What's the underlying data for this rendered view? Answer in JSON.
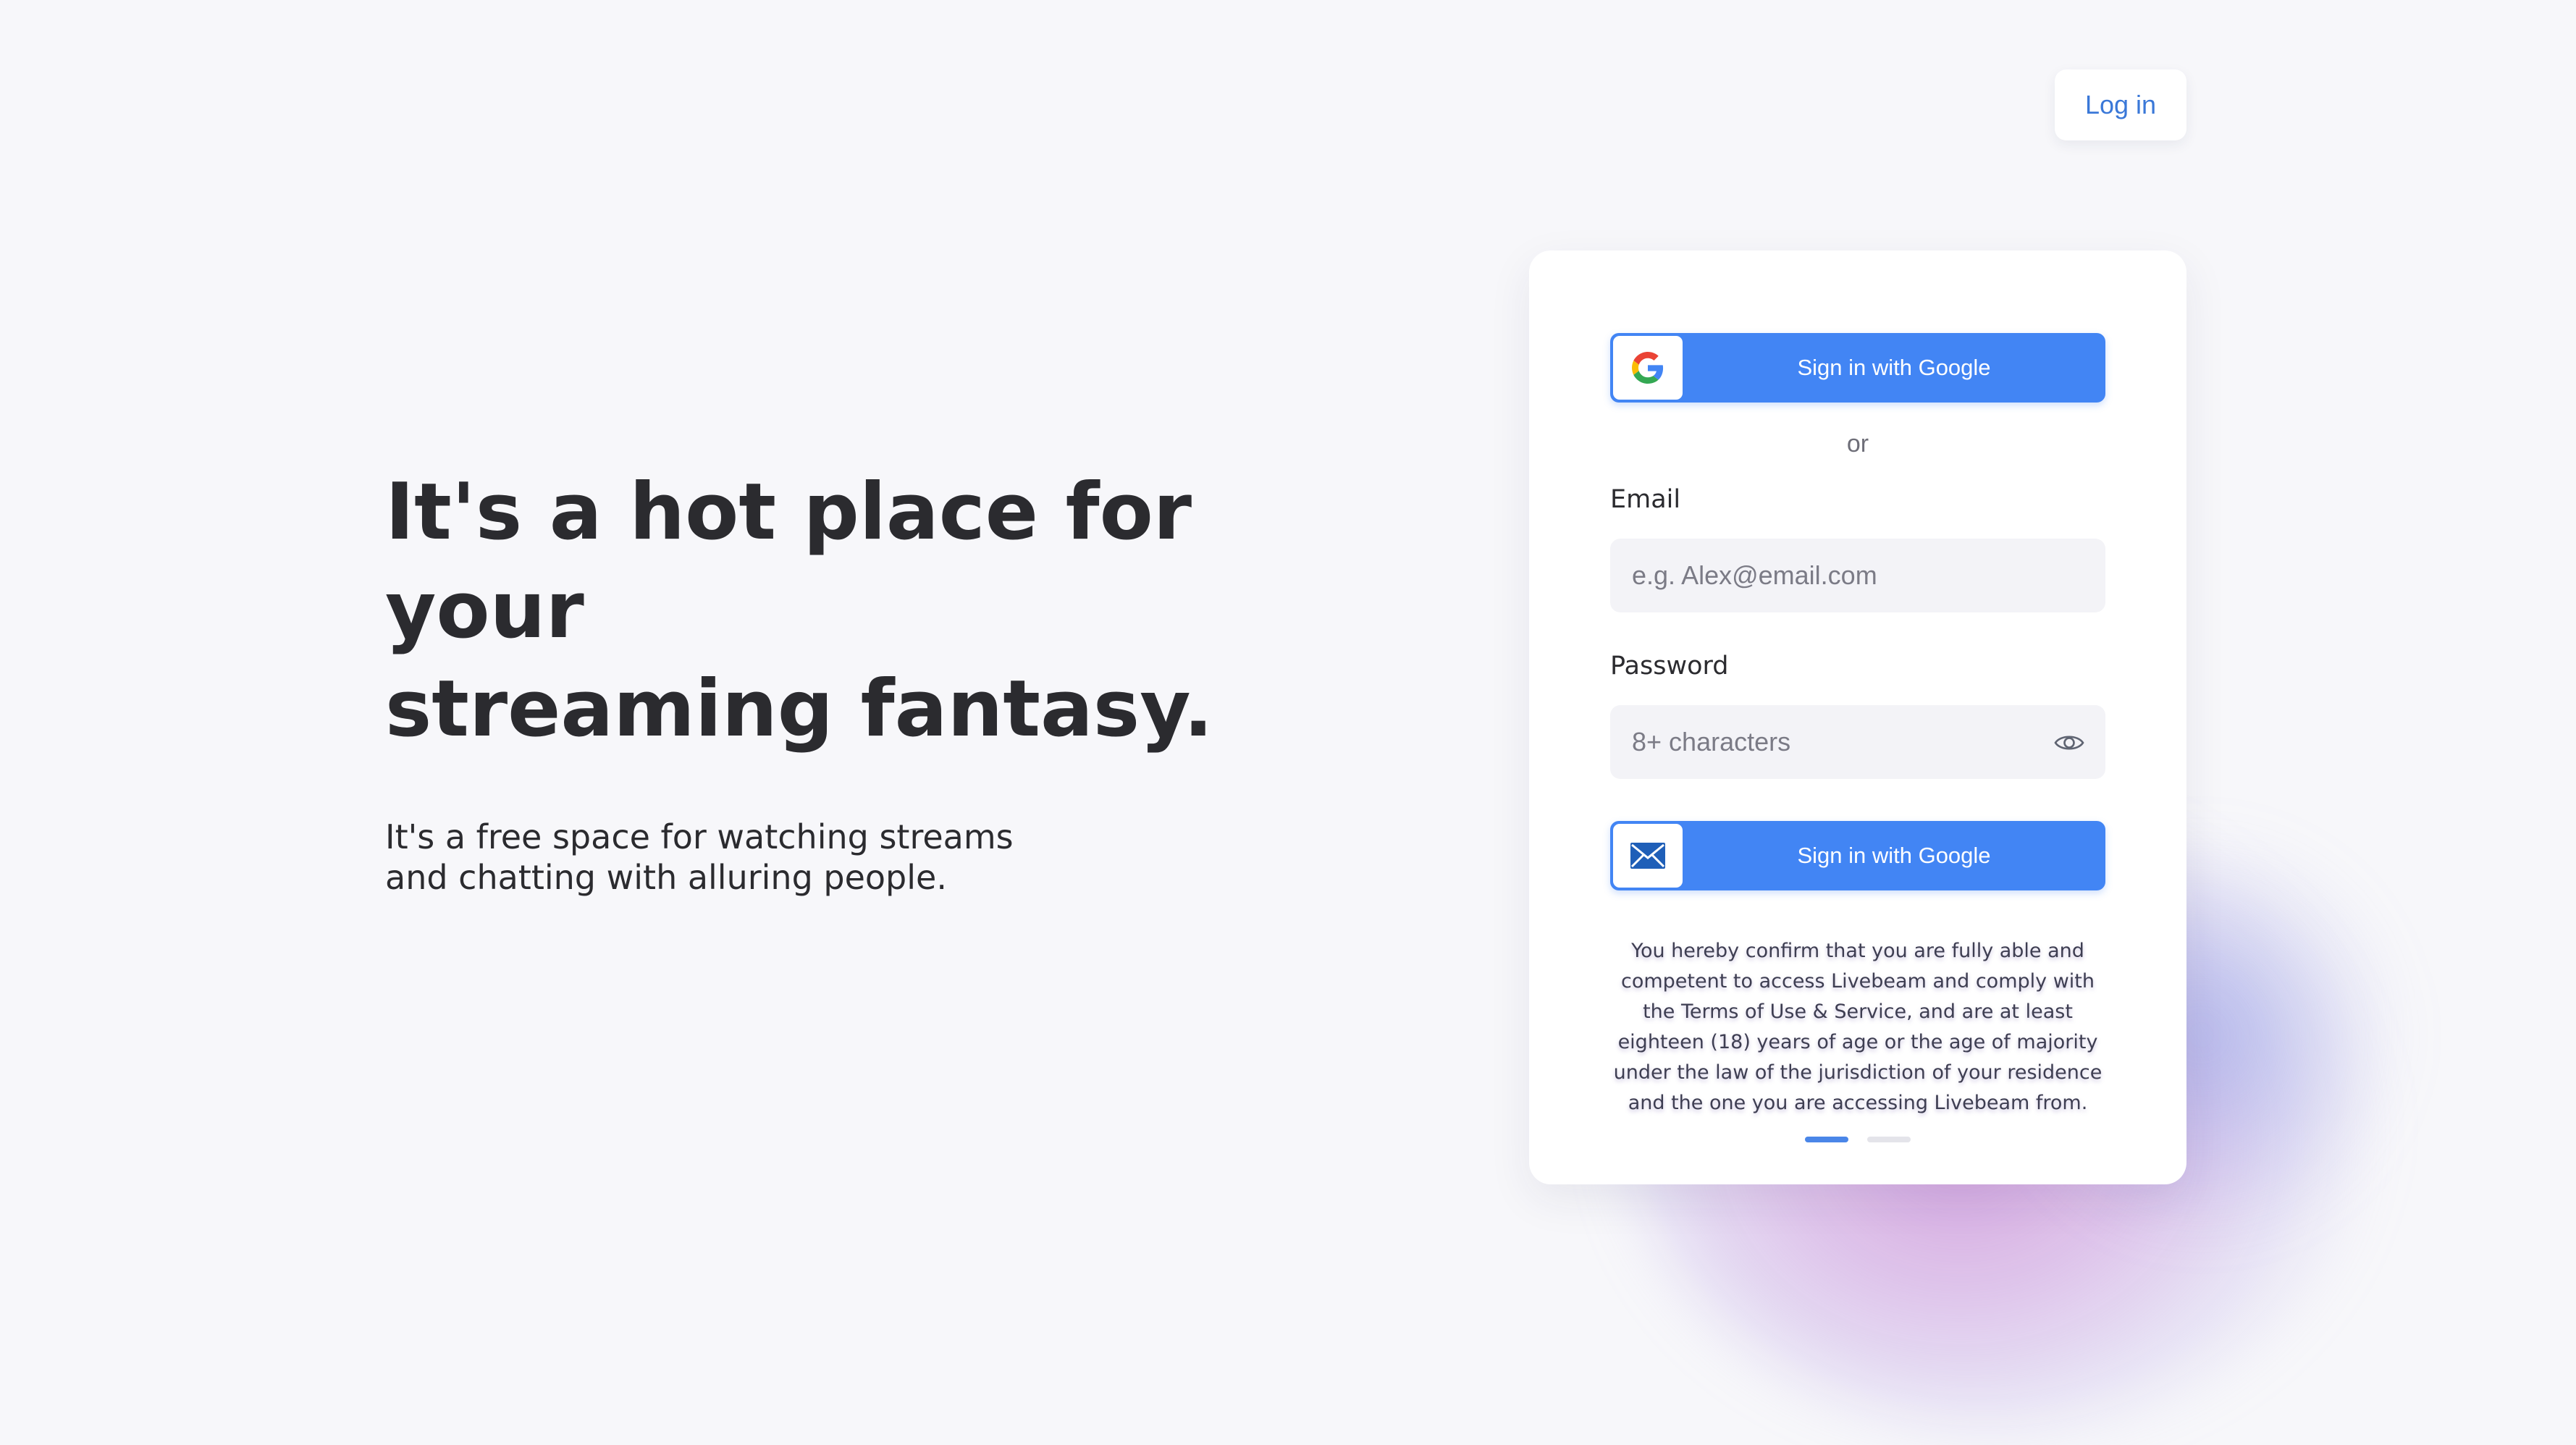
{
  "header": {
    "login_label": "Log in"
  },
  "hero": {
    "title": "It's a hot place for your\nstreaming fantasy.",
    "subtitle": "It's a free space for watching streams\nand chatting with alluring people."
  },
  "signin_card": {
    "google_button_label": "Sign in with Google",
    "google_icon": "google-g-icon",
    "separator": "or",
    "email_label": "Email",
    "email_placeholder": "e.g. Alex@email.com",
    "email_value": "",
    "password_label": "Password",
    "password_placeholder": "8+ characters",
    "password_value": "",
    "password_toggle_icon": "eye-icon",
    "email_button_label": "Sign in with Google",
    "email_icon": "envelope-icon",
    "legal_text": "You hereby confirm that you are fully able and competent to access Livebeam and comply with the Terms of Use & Service, and are at least eighteen (18) years of age or the age of majority under the law of the jurisdiction of your residence and the one you are accessing Livebeam from.",
    "pagination": {
      "total": 2,
      "active": 1
    }
  },
  "colors": {
    "accent": "#4285f4",
    "link": "#3a78d8",
    "background": "#f7f7fa",
    "text": "#2b2b2f"
  }
}
